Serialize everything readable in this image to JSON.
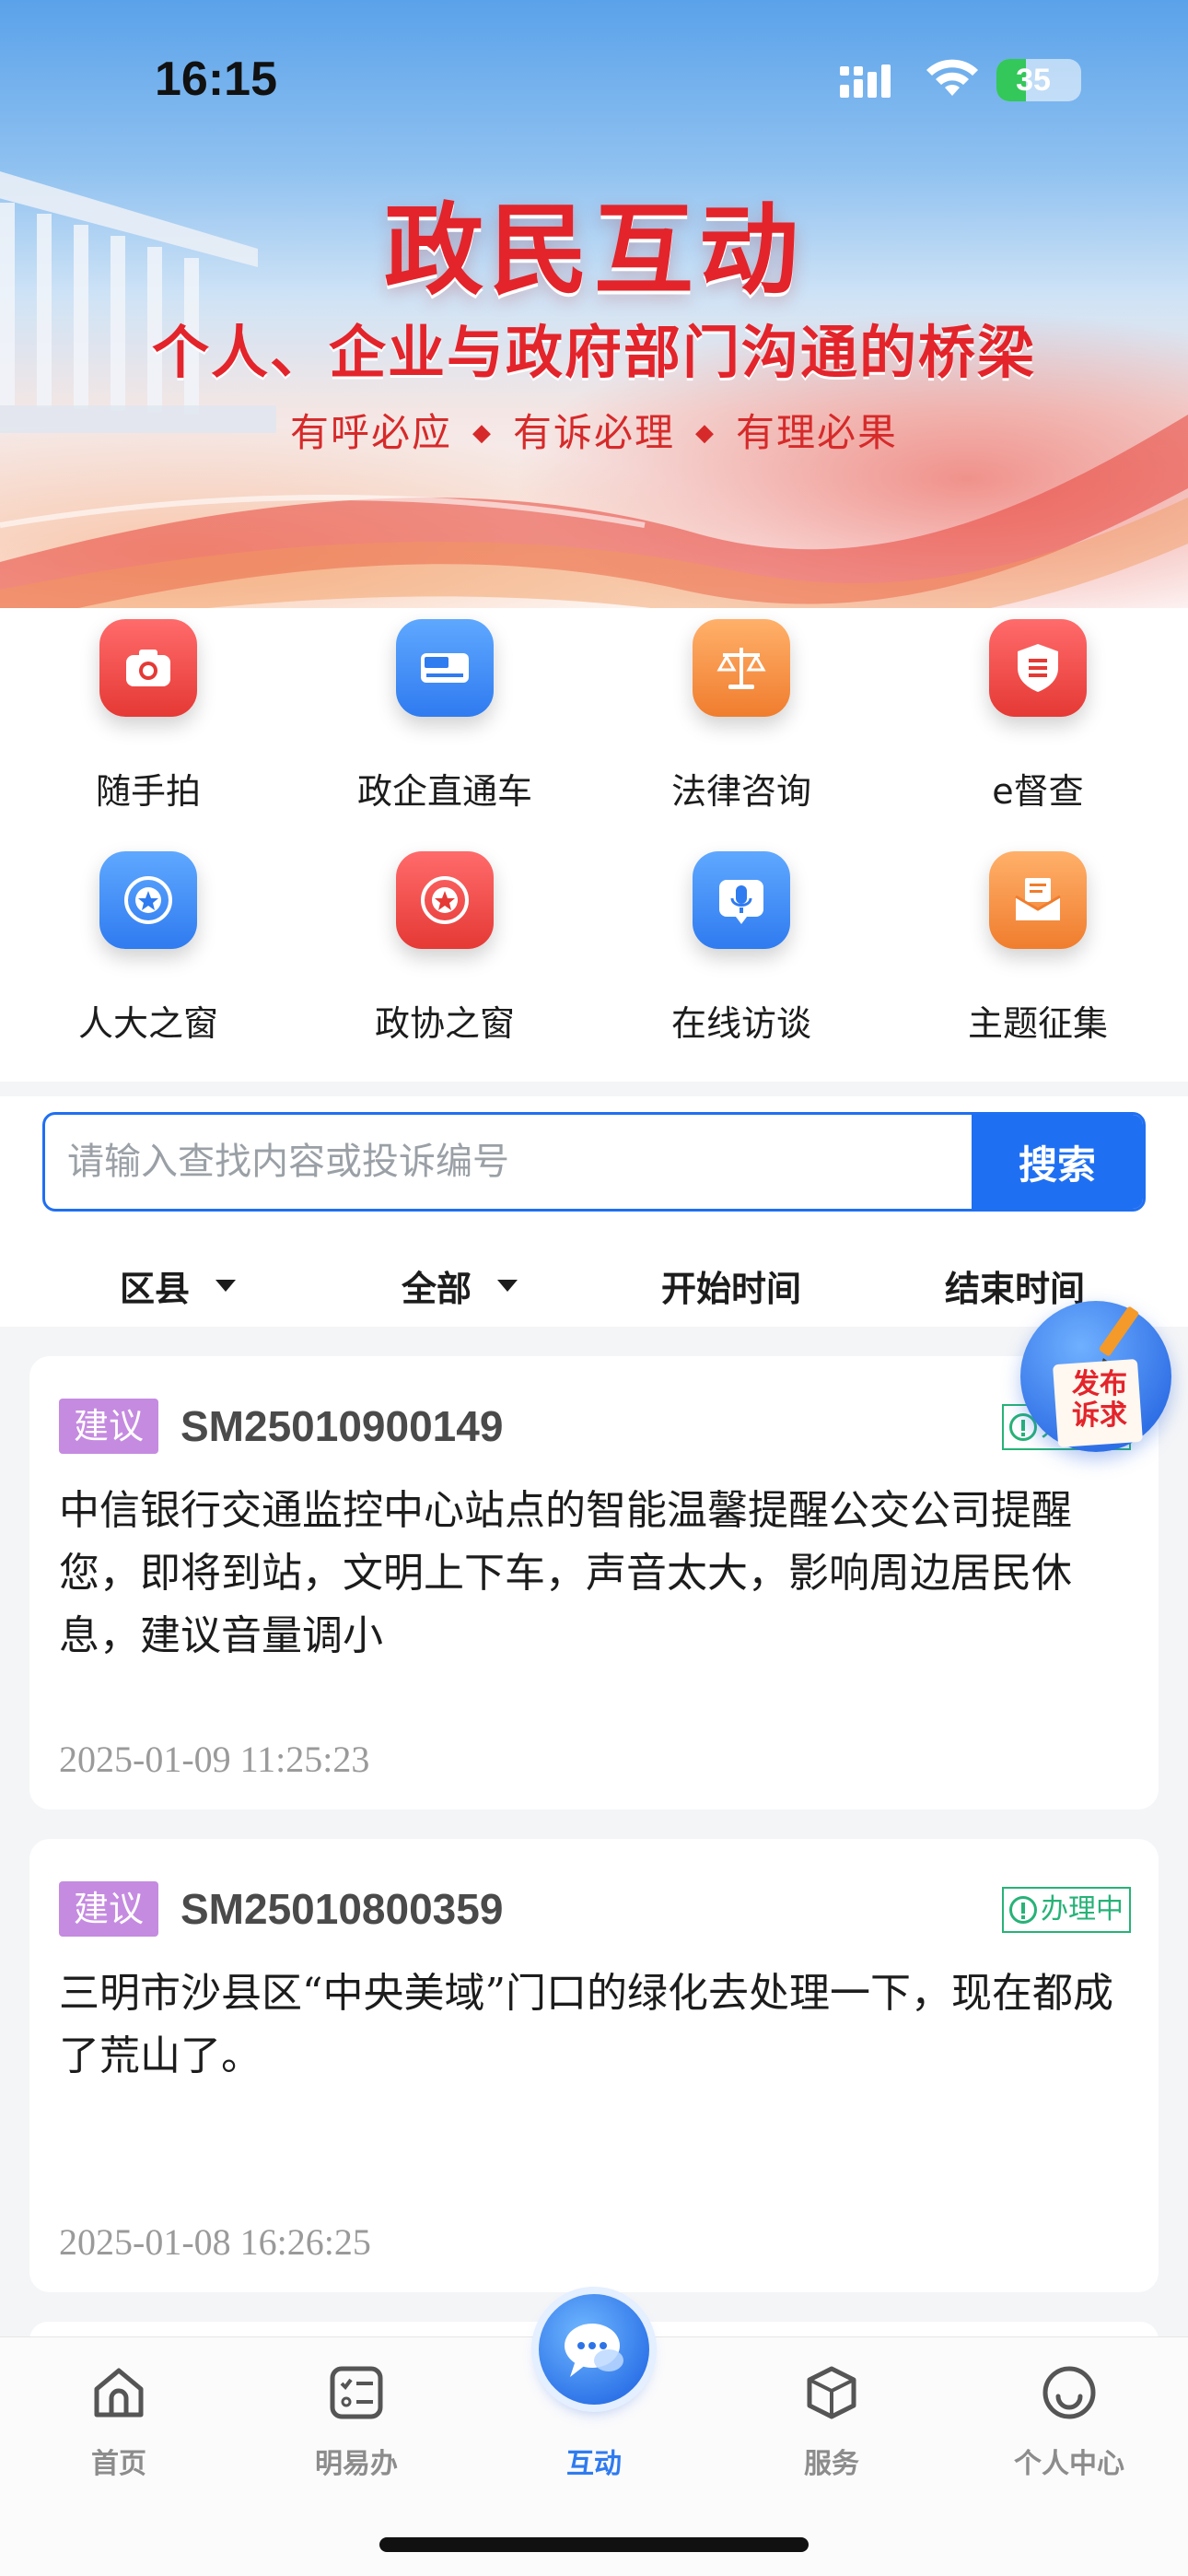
{
  "status_bar": {
    "time": "16:15",
    "battery": "35",
    "battery_level": 0.35
  },
  "hero": {
    "title": "政民互动",
    "subtitle": "个人、企业与政府部门沟通的桥梁",
    "slogans": [
      "有呼必应",
      "有诉必理",
      "有理必果"
    ],
    "separator": "◆"
  },
  "services": [
    {
      "label": "随手拍",
      "icon": "camera-icon",
      "color": "#e53935"
    },
    {
      "label": "政企直通车",
      "icon": "enterprise-bus-icon",
      "color": "#2f7bf0"
    },
    {
      "label": "法律咨询",
      "icon": "scales-icon",
      "color": "#f07d2e"
    },
    {
      "label": "e督查",
      "icon": "supervise-shield-icon",
      "color": "#e53935"
    },
    {
      "label": "人大之窗",
      "icon": "national-emblem-icon",
      "color": "#2f7bf0"
    },
    {
      "label": "政协之窗",
      "icon": "cppcc-emblem-icon",
      "color": "#e53935"
    },
    {
      "label": "在线访谈",
      "icon": "microphone-icon",
      "color": "#2f7bf0"
    },
    {
      "label": "主题征集",
      "icon": "envelope-icon",
      "color": "#f07d2e"
    }
  ],
  "search": {
    "placeholder": "请输入查找内容或投诉编号",
    "button": "搜索"
  },
  "filters": {
    "district": "区县",
    "category": "全部",
    "start_time": "开始时间",
    "end_time": "结束时间"
  },
  "fab": {
    "line1": "发布",
    "line2": "诉求"
  },
  "items": [
    {
      "tag": "建议",
      "id": "SM25010900149",
      "status": "办理中",
      "content": "中信银行交通监控中心站点的智能温馨提醒公交公司提醒您，即将到站，文明上下车，声音太大，影响周边居民休息，建议音量调小",
      "date": "2025-01-09 11:25:23"
    },
    {
      "tag": "建议",
      "id": "SM25010800359",
      "status": "办理中",
      "content": "三明市沙县区“中央美域”门口的绿化去处理一下，现在都成了荒山了。",
      "date": "2025-01-08 16:26:25"
    }
  ],
  "nav": [
    {
      "label": "首页",
      "icon": "home-icon"
    },
    {
      "label": "明易办",
      "icon": "checklist-icon"
    },
    {
      "label": "互动",
      "icon": "chat-bubble-icon",
      "active": true
    },
    {
      "label": "服务",
      "icon": "cube-icon"
    },
    {
      "label": "个人中心",
      "icon": "smiley-icon"
    }
  ],
  "colors": {
    "accent": "#1f6ff2",
    "brand_red": "#e3242b",
    "tag_purple": "#c58be0",
    "status_green": "#27b277"
  }
}
